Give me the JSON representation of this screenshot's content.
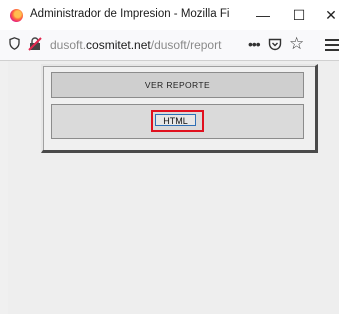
{
  "window": {
    "title": "Administrador de Impresion - Mozilla Firef...",
    "minimize": "—",
    "maximize": "☐",
    "close": "✕"
  },
  "navbar": {
    "url_prefix": "dusoft.",
    "url_domain": "cosmitet.net",
    "url_path": "/dusoft/report",
    "page_actions": "•••",
    "star": "☆"
  },
  "report": {
    "header_label": "VER REPORTE",
    "html_button_label": "HTML"
  },
  "colors": {
    "highlight": "#e0101e",
    "button_border": "#2e6fb5"
  }
}
